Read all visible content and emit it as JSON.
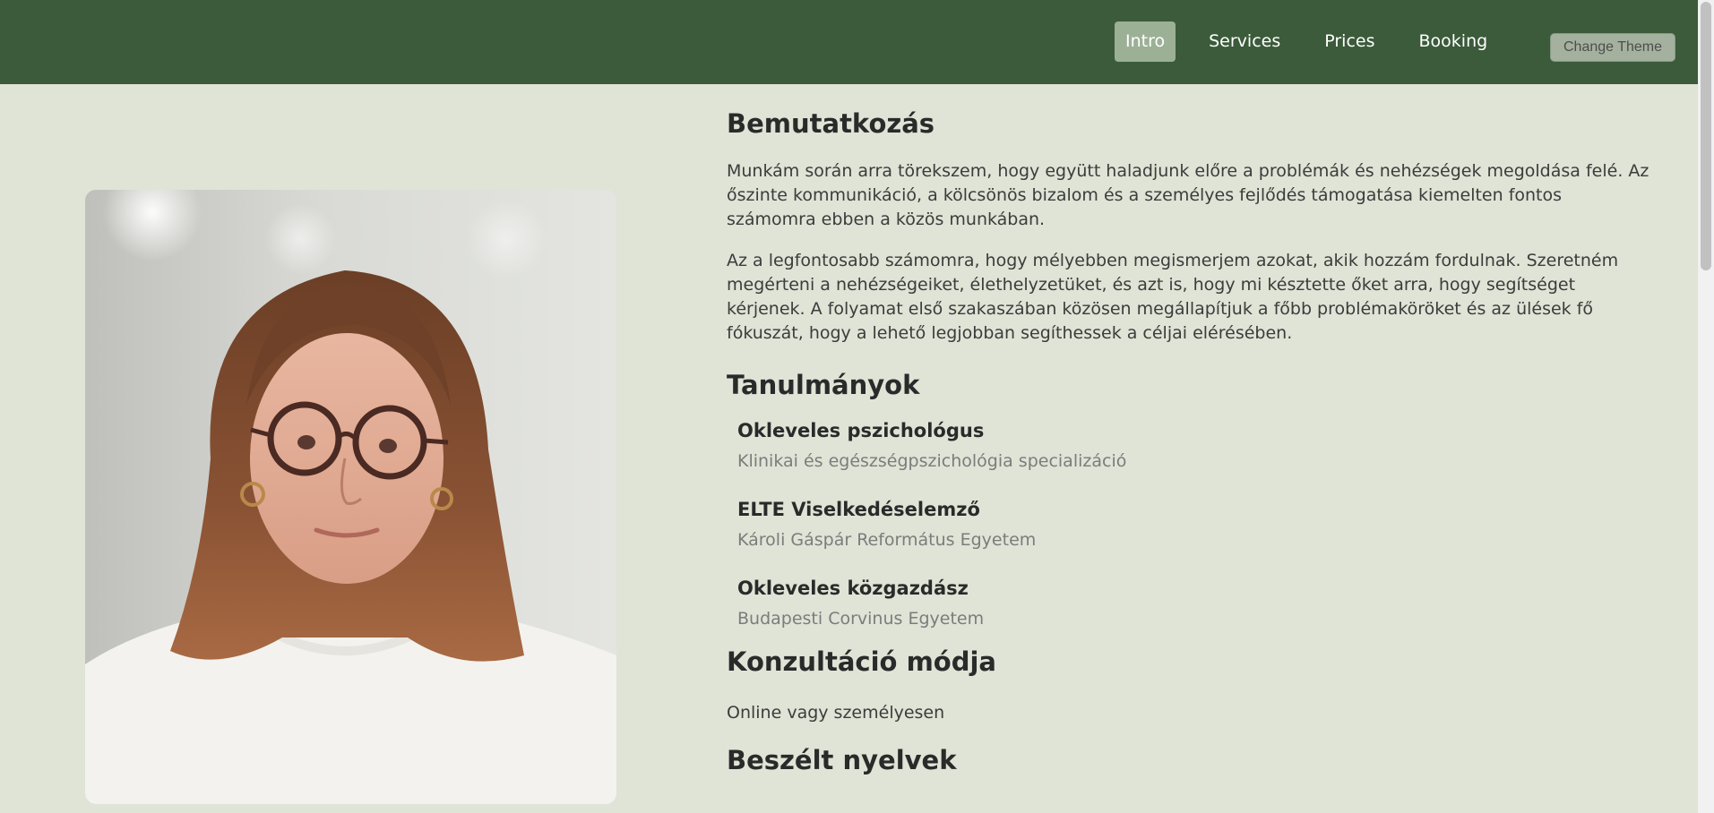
{
  "nav": {
    "items": [
      {
        "label": "Intro",
        "active": true
      },
      {
        "label": "Services",
        "active": false
      },
      {
        "label": "Prices",
        "active": false
      },
      {
        "label": "Booking",
        "active": false
      }
    ],
    "theme_button": "Change Theme"
  },
  "intro": {
    "title": "Bemutatkozás",
    "p1": "Munkám során arra törekszem, hogy együtt haladjunk előre a problémák és nehézségek megoldása felé. Az őszinte kommunikáció, a kölcsönös bizalom és a személyes fejlődés támogatása kiemelten fontos számomra ebben a közös munkában.",
    "p2": "Az a legfontosabb számomra, hogy mélyebben megismerjem azokat, akik hozzám fordulnak. Szeretném megérteni a nehézségeiket, élethelyzetüket, és azt is, hogy mi késztette őket arra, hogy segítséget kérjenek. A folyamat első szakaszában közösen megállapítjuk a főbb problémaköröket és az ülések fő fókuszát, hogy a lehető legjobban segíthessek a céljai elérésében."
  },
  "studies": {
    "title": "Tanulmányok",
    "items": [
      {
        "title": "Okleveles pszichológus",
        "sub": "Klinikai és egészségpszichológia specializáció"
      },
      {
        "title": "ELTE Viselkedéselemző",
        "sub": "Károli Gáspár Református Egyetem"
      },
      {
        "title": "Okleveles közgazdász",
        "sub": "Budapesti Corvinus Egyetem"
      }
    ]
  },
  "consultation": {
    "title": "Konzultáció módja",
    "text": "Online vagy személyesen"
  },
  "languages": {
    "title": "Beszélt nyelvek"
  },
  "colors": {
    "navbar": "#3b5b3a",
    "page_background": "#dfe4d6",
    "active_nav": "#9cb095"
  }
}
